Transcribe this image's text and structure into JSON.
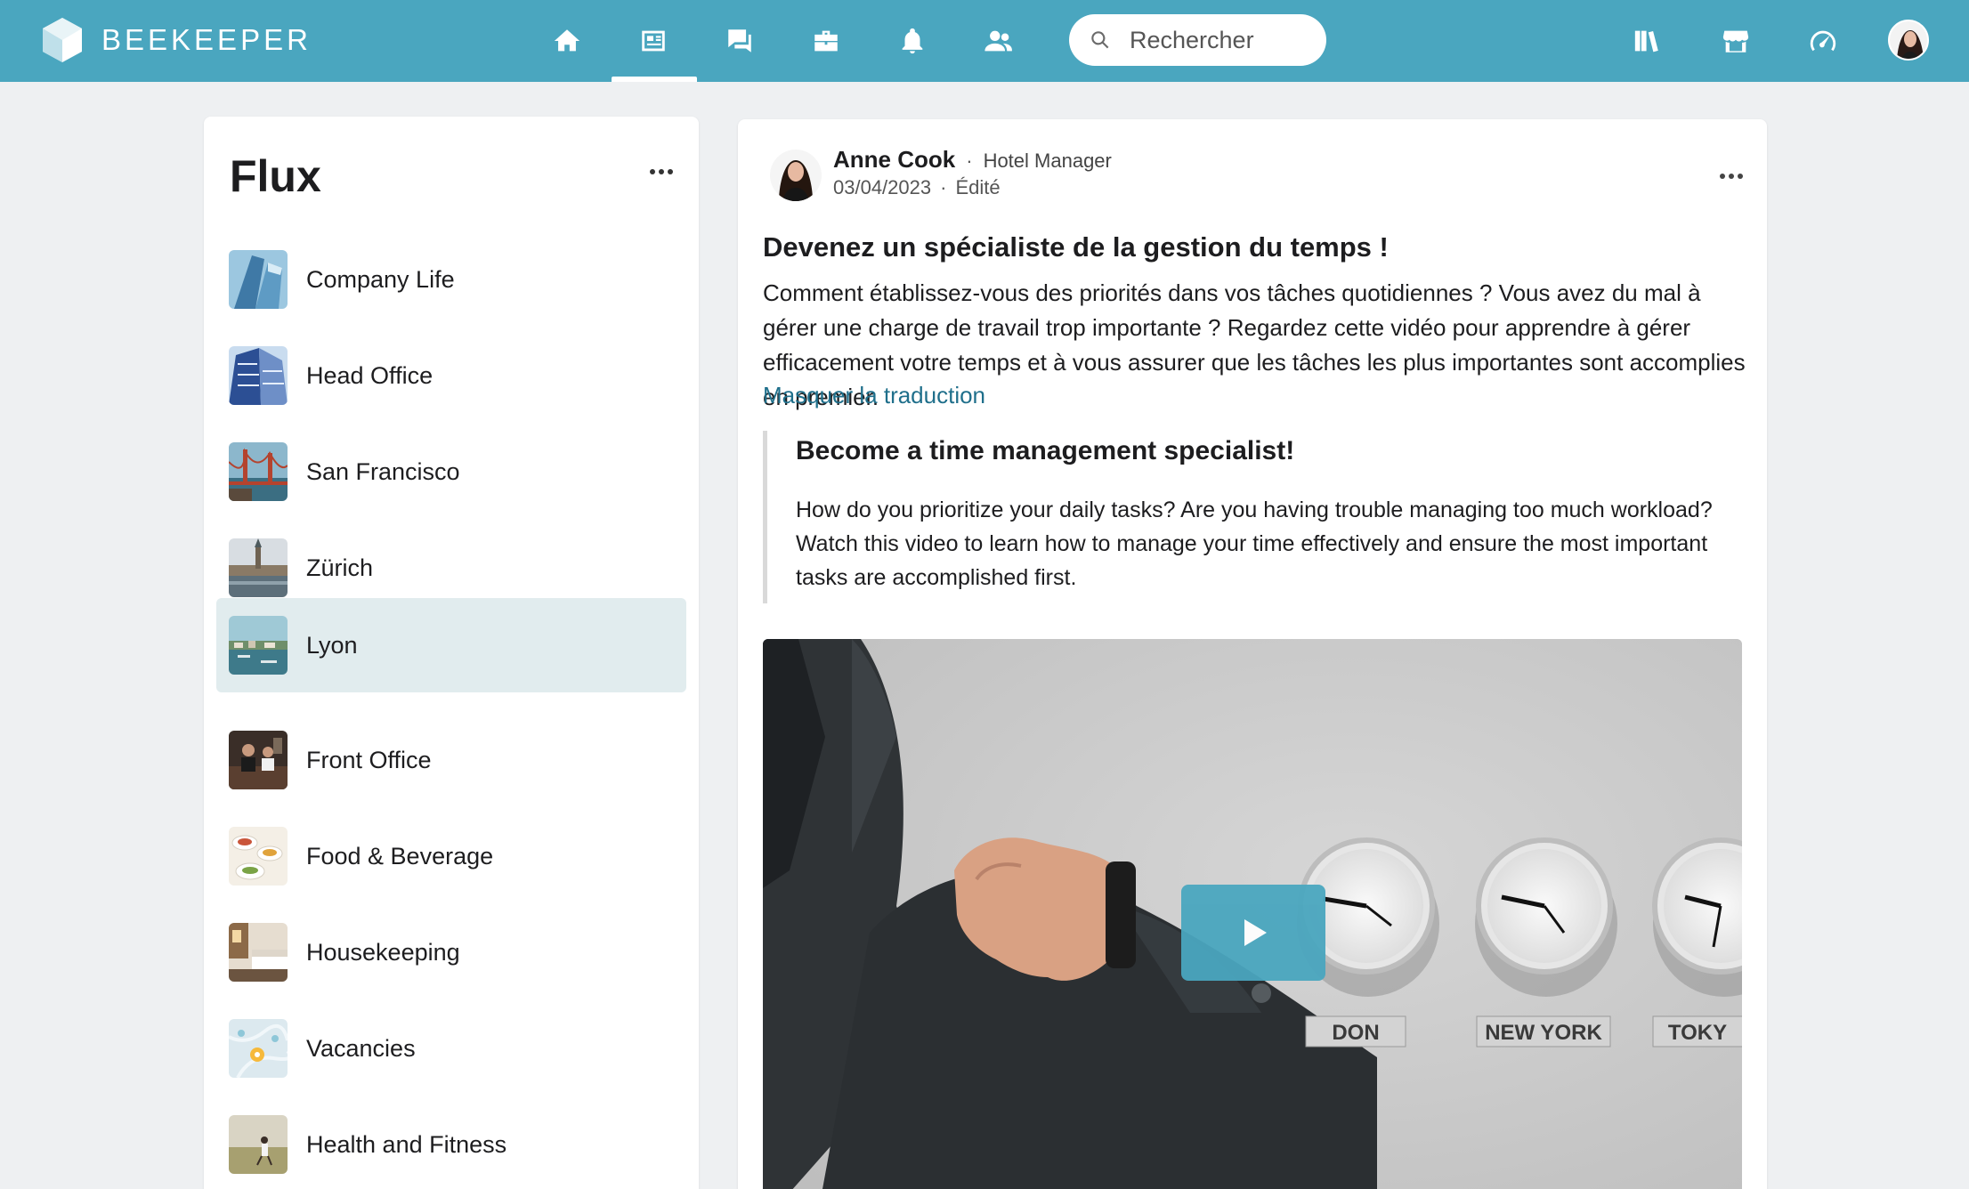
{
  "app": {
    "brand_name": "BEEKEEPER",
    "accent_color": "#4aa6bf"
  },
  "nav": {
    "icons": [
      "home-icon",
      "stream-icon",
      "chat-icon",
      "toolbox-icon",
      "bell-icon",
      "people-icon"
    ],
    "active": "stream-icon",
    "right_icons": [
      "library-icon",
      "market-icon",
      "dashboard-icon"
    ]
  },
  "search": {
    "placeholder": "Rechercher"
  },
  "streams": {
    "title": "Flux",
    "items": [
      {
        "label": "Company Life",
        "thumb": "buildings"
      },
      {
        "label": "Head Office",
        "thumb": "office-tower"
      },
      {
        "label": "San Francisco",
        "thumb": "golden-gate"
      },
      {
        "label": "Zürich",
        "thumb": "river-town"
      },
      {
        "label": "Lyon",
        "thumb": "harbor",
        "active": true
      },
      {
        "label": "Front Office",
        "thumb": "reception"
      },
      {
        "label": "Food & Beverage",
        "thumb": "food"
      },
      {
        "label": "Housekeeping",
        "thumb": "bedroom"
      },
      {
        "label": "Vacancies",
        "thumb": "map-pins"
      },
      {
        "label": "Health and Fitness",
        "thumb": "field"
      }
    ]
  },
  "post": {
    "author_name": "Anne Cook",
    "author_role": "Hotel Manager",
    "date": "03/04/2023",
    "edited": "Édité",
    "title": "Devenez un spécialiste de la gestion du temps !",
    "body": "Comment établissez-vous des priorités dans vos tâches quotidiennes ? Vous avez du mal à gérer une charge de travail trop importante ? Regardez cette vidéo pour apprendre à gérer efficacement votre temps et à vous assurer que les tâches les plus importantes sont accomplies en premier.",
    "translate_toggle": "Masquer la traduction",
    "translation_title": "Become a time management specialist!",
    "translation_body": "How do you prioritize your daily tasks? Are you having trouble managing too much workload? Watch this video to learn how to manage your time effectively and ensure the most important tasks are accomplished first.",
    "video": {
      "clock_labels": [
        "DON",
        "NEW YORK",
        "TOKY"
      ]
    }
  }
}
